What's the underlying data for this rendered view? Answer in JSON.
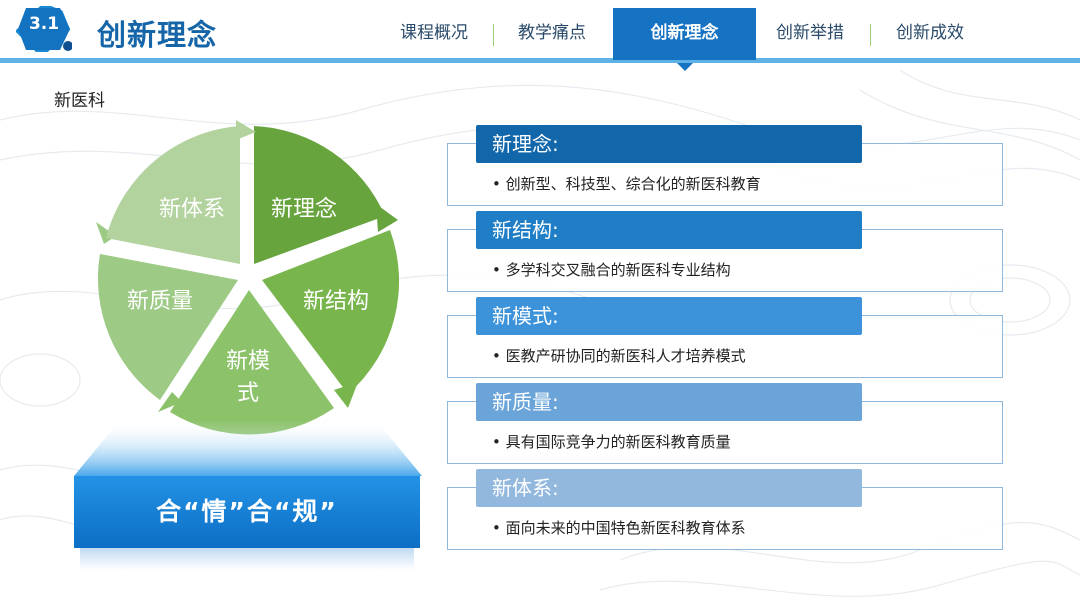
{
  "header": {
    "section_number": "3.1",
    "title": "创新理念",
    "nav": [
      {
        "label": "课程概况",
        "active": false
      },
      {
        "label": "教学痛点",
        "active": false
      },
      {
        "label": "创新理念",
        "active": true
      },
      {
        "label": "创新举措",
        "active": false
      },
      {
        "label": "创新成效",
        "active": false
      }
    ]
  },
  "subtitle": "新医科",
  "cycle": {
    "segments": [
      {
        "label": "新理念",
        "color": "#67a43e"
      },
      {
        "label": "新结构",
        "color": "#78b54c"
      },
      {
        "label_line1": "新模",
        "label_line2": "式",
        "color": "#8cc26a"
      },
      {
        "label": "新质量",
        "color": "#9dca85"
      },
      {
        "label": "新体系",
        "color": "#b2d39e"
      }
    ]
  },
  "pedestal": {
    "text": "合“情”合“规”",
    "color": "#1680d8"
  },
  "cards": [
    {
      "title": "新理念:",
      "text": "创新型、科技型、综合化的新医科教育",
      "color": "#1266aa"
    },
    {
      "title": "新结构:",
      "text": "多学科交叉融合的新医科专业结构",
      "color": "#1f7ec6"
    },
    {
      "title": "新模式:",
      "text": "医教产研协同的新医科人才培养模式",
      "color": "#3d93d9"
    },
    {
      "title": "新质量:",
      "text": "具有国际竞争力的新医科教育质量",
      "color": "#6aa4d8"
    },
    {
      "title": "新体系:",
      "text": "面向未来的中国特色新医科教育体系",
      "color": "#93b8de"
    }
  ]
}
